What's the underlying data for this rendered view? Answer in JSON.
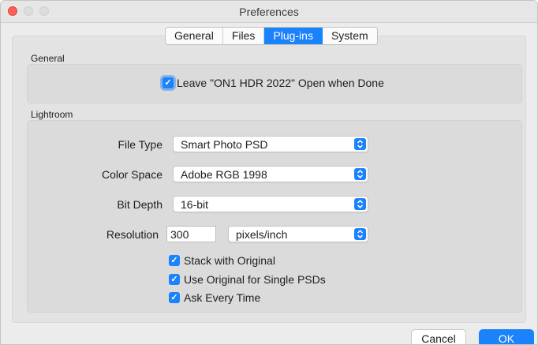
{
  "window": {
    "title": "Preferences"
  },
  "tabs": [
    {
      "label": "General",
      "active": false
    },
    {
      "label": "Files",
      "active": false
    },
    {
      "label": "Plug-ins",
      "active": true
    },
    {
      "label": "System",
      "active": false
    }
  ],
  "general": {
    "section_label": "General",
    "leave_open": {
      "label": "Leave \"ON1 HDR 2022\" Open when Done",
      "checked": true
    }
  },
  "lightroom": {
    "section_label": "Lightroom",
    "file_type": {
      "label": "File Type",
      "value": "Smart Photo PSD"
    },
    "color_space": {
      "label": "Color Space",
      "value": "Adobe RGB 1998"
    },
    "bit_depth": {
      "label": "Bit Depth",
      "value": "16-bit"
    },
    "resolution": {
      "label": "Resolution",
      "value": "300",
      "unit": "pixels/inch"
    },
    "stack_with_original": {
      "label": "Stack with Original",
      "checked": true
    },
    "use_original": {
      "label": "Use Original for Single PSDs",
      "checked": true
    },
    "ask_every_time": {
      "label": "Ask Every Time",
      "checked": true
    }
  },
  "buttons": {
    "cancel": "Cancel",
    "ok": "OK"
  },
  "colors": {
    "accent": "#1a82fb",
    "close": "#fe5f57"
  },
  "icons": {
    "checkbox": "checkmark-icon",
    "select": "chevron-updown-icon"
  }
}
